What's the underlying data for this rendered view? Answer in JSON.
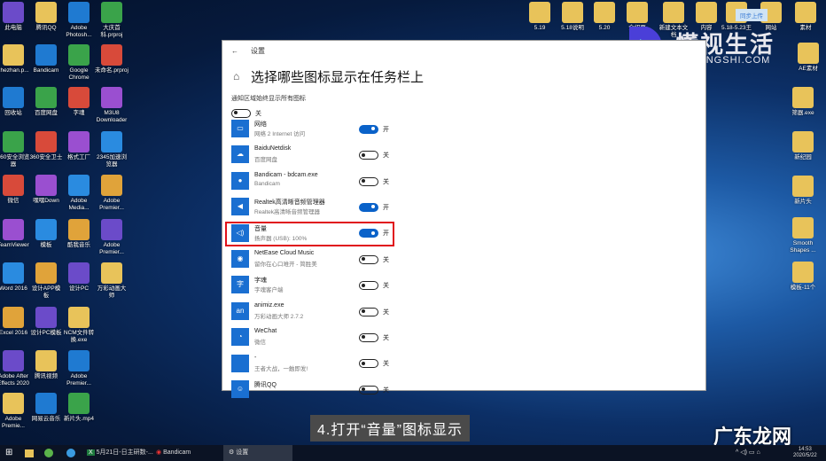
{
  "desktop_left": [
    [
      "此电脑",
      "腾讯QQ",
      "Adobe Photosh...",
      "大庆首科.prproj"
    ],
    [
      "zhezhan.p...",
      "Bandicam",
      "Google Chrome",
      "未命名.prproj"
    ],
    [
      "回收站",
      "百度网盘",
      "字魂",
      "M3U8 Downloader"
    ],
    [
      "360安全浏览器",
      "360安全卫士",
      "格式工厂",
      "2345加速浏览器"
    ],
    [
      "微信",
      "嘿嘿Down",
      "Adobe Media...",
      "Adobe Premier..."
    ],
    [
      "TeamViewer",
      "模板",
      "酷我音乐",
      "Adobe Premier..."
    ],
    [
      "Word 2016",
      "设计APP模板",
      "设计PC",
      "万彩动画大师"
    ],
    [
      "Excel 2016",
      "设计PC模板",
      "NCM文件转换.exe",
      ""
    ],
    [
      "Adobe After Effects 2020",
      "腾讯视频",
      "Adobe Premier...",
      ""
    ],
    [
      "Adobe Premie...",
      "网易云音乐",
      "新片头.mp4",
      ""
    ]
  ],
  "desktop_top": [
    "5.19",
    "5.18说明",
    "5.20",
    "介绍页",
    "新建文本文档",
    "内容",
    "5.18-5.23王",
    "网站",
    "素材"
  ],
  "desktop_right": [
    "AE素材",
    "筛器.exe",
    "新纪园",
    "新片头",
    "Smooth Shapes ...",
    "模板-11个"
  ],
  "cloud_badge": "同步上传",
  "logo": {
    "cn": "懂视生活",
    "en": "51DONGSHI.COM"
  },
  "window": {
    "back": "←",
    "title": "设置",
    "heading": "选择哪些图标显示在任务栏上",
    "always_show_label": "通知区域始终显示所有图标",
    "always_show_state": "关",
    "items": [
      {
        "name": "网络",
        "sub": "网络 2 Internet 访问",
        "state": "开",
        "on": true,
        "icon": "▭"
      },
      {
        "name": "BaiduNetdisk",
        "sub": "百度网盘",
        "state": "关",
        "on": false,
        "icon": "☁"
      },
      {
        "name": "Bandicam - bdcam.exe",
        "sub": "Bandicam",
        "state": "关",
        "on": false,
        "icon": "●"
      },
      {
        "name": "Realtek高清晰音频管理器",
        "sub": "Realtek高清晰音频管理器",
        "state": "开",
        "on": true,
        "icon": "◀"
      },
      {
        "name": "音量",
        "sub": "扬声器 (USB): 100%",
        "state": "开",
        "on": true,
        "icon": "◁)"
      },
      {
        "name": "NetEase Cloud Music",
        "sub": "留你在心口难开 - 简胜美",
        "state": "关",
        "on": false,
        "icon": "◉"
      },
      {
        "name": "字魂",
        "sub": "字魂客户端",
        "state": "关",
        "on": false,
        "icon": "字"
      },
      {
        "name": "animiz.exe",
        "sub": "万彩动画大师 2.7.2",
        "state": "关",
        "on": false,
        "icon": "an"
      },
      {
        "name": "WeChat",
        "sub": "微信",
        "state": "关",
        "on": false,
        "icon": "◔"
      },
      {
        "name": "-",
        "sub": "王者大战，一触即发!",
        "state": "关",
        "on": false,
        "icon": ""
      },
      {
        "name": "腾讯QQ",
        "sub": "",
        "state": "关",
        "on": false,
        "icon": "☺"
      }
    ]
  },
  "caption": "4.打开“音量”图标显示",
  "watermark": "广东龙网",
  "taskbar": {
    "excel": "5月21日-日主研数-...",
    "bandicam": "Bandicam",
    "settings": "设置",
    "time": "14:53",
    "date": "2020/5/22"
  }
}
